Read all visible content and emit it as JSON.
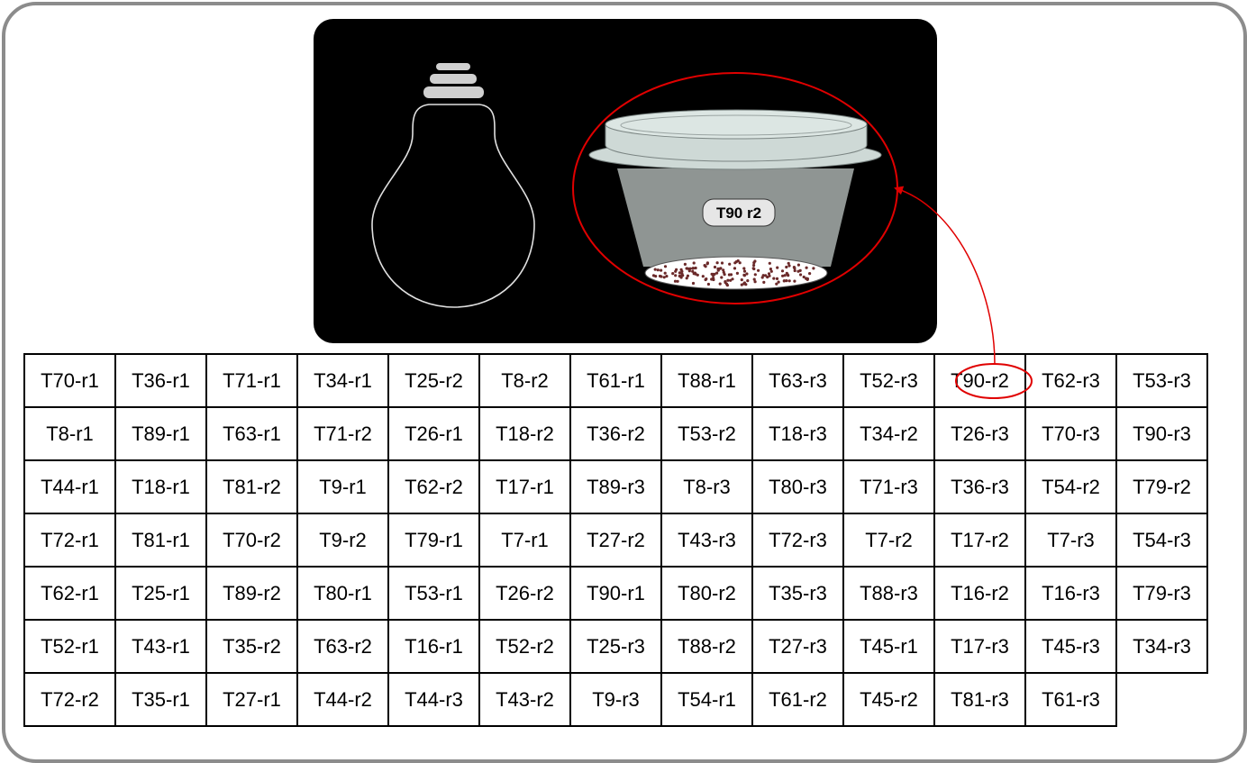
{
  "pot_label": "T90 r2",
  "highlighted_cell": "T90-r2",
  "colors": {
    "frame": "#8c8c8c",
    "highlight": "#e00000",
    "scene_bg": "#000000"
  },
  "grid": [
    [
      "T70-r1",
      "T36-r1",
      "T71-r1",
      "T34-r1",
      "T25-r2",
      "T8-r2",
      "T61-r1",
      "T88-r1",
      "T63-r3",
      "T52-r3",
      "T90-r2",
      "T62-r3",
      "T53-r3"
    ],
    [
      "T8-r1",
      "T89-r1",
      "T63-r1",
      "T71-r2",
      "T26-r1",
      "T18-r2",
      "T36-r2",
      "T53-r2",
      "T18-r3",
      "T34-r2",
      "T26-r3",
      "T70-r3",
      "T90-r3"
    ],
    [
      "T44-r1",
      "T18-r1",
      "T81-r2",
      "T9-r1",
      "T62-r2",
      "T17-r1",
      "T89-r3",
      "T8-r3",
      "T80-r3",
      "T71-r3",
      "T36-r3",
      "T54-r2",
      "T79-r2"
    ],
    [
      "T72-r1",
      "T81-r1",
      "T70-r2",
      "T9-r2",
      "T79-r1",
      "T7-r1",
      "T27-r2",
      "T43-r3",
      "T72-r3",
      "T7-r2",
      "T17-r2",
      "T7-r3",
      "T54-r3"
    ],
    [
      "T62-r1",
      "T25-r1",
      "T89-r2",
      "T80-r1",
      "T53-r1",
      "T26-r2",
      "T90-r1",
      "T80-r2",
      "T35-r3",
      "T88-r3",
      "T16-r2",
      "T16-r3",
      "T79-r3"
    ],
    [
      "T52-r1",
      "T43-r1",
      "T35-r2",
      "T63-r2",
      "T16-r1",
      "T52-r2",
      "T25-r3",
      "T88-r2",
      "T27-r3",
      "T45-r1",
      "T17-r3",
      "T45-r3",
      "T34-r3"
    ],
    [
      "T72-r2",
      "T35-r1",
      "T27-r1",
      "T44-r2",
      "T44-r3",
      "T43-r2",
      "T9-r3",
      "T54-r1",
      "T61-r2",
      "T45-r2",
      "T81-r3",
      "T61-r3",
      ""
    ]
  ]
}
